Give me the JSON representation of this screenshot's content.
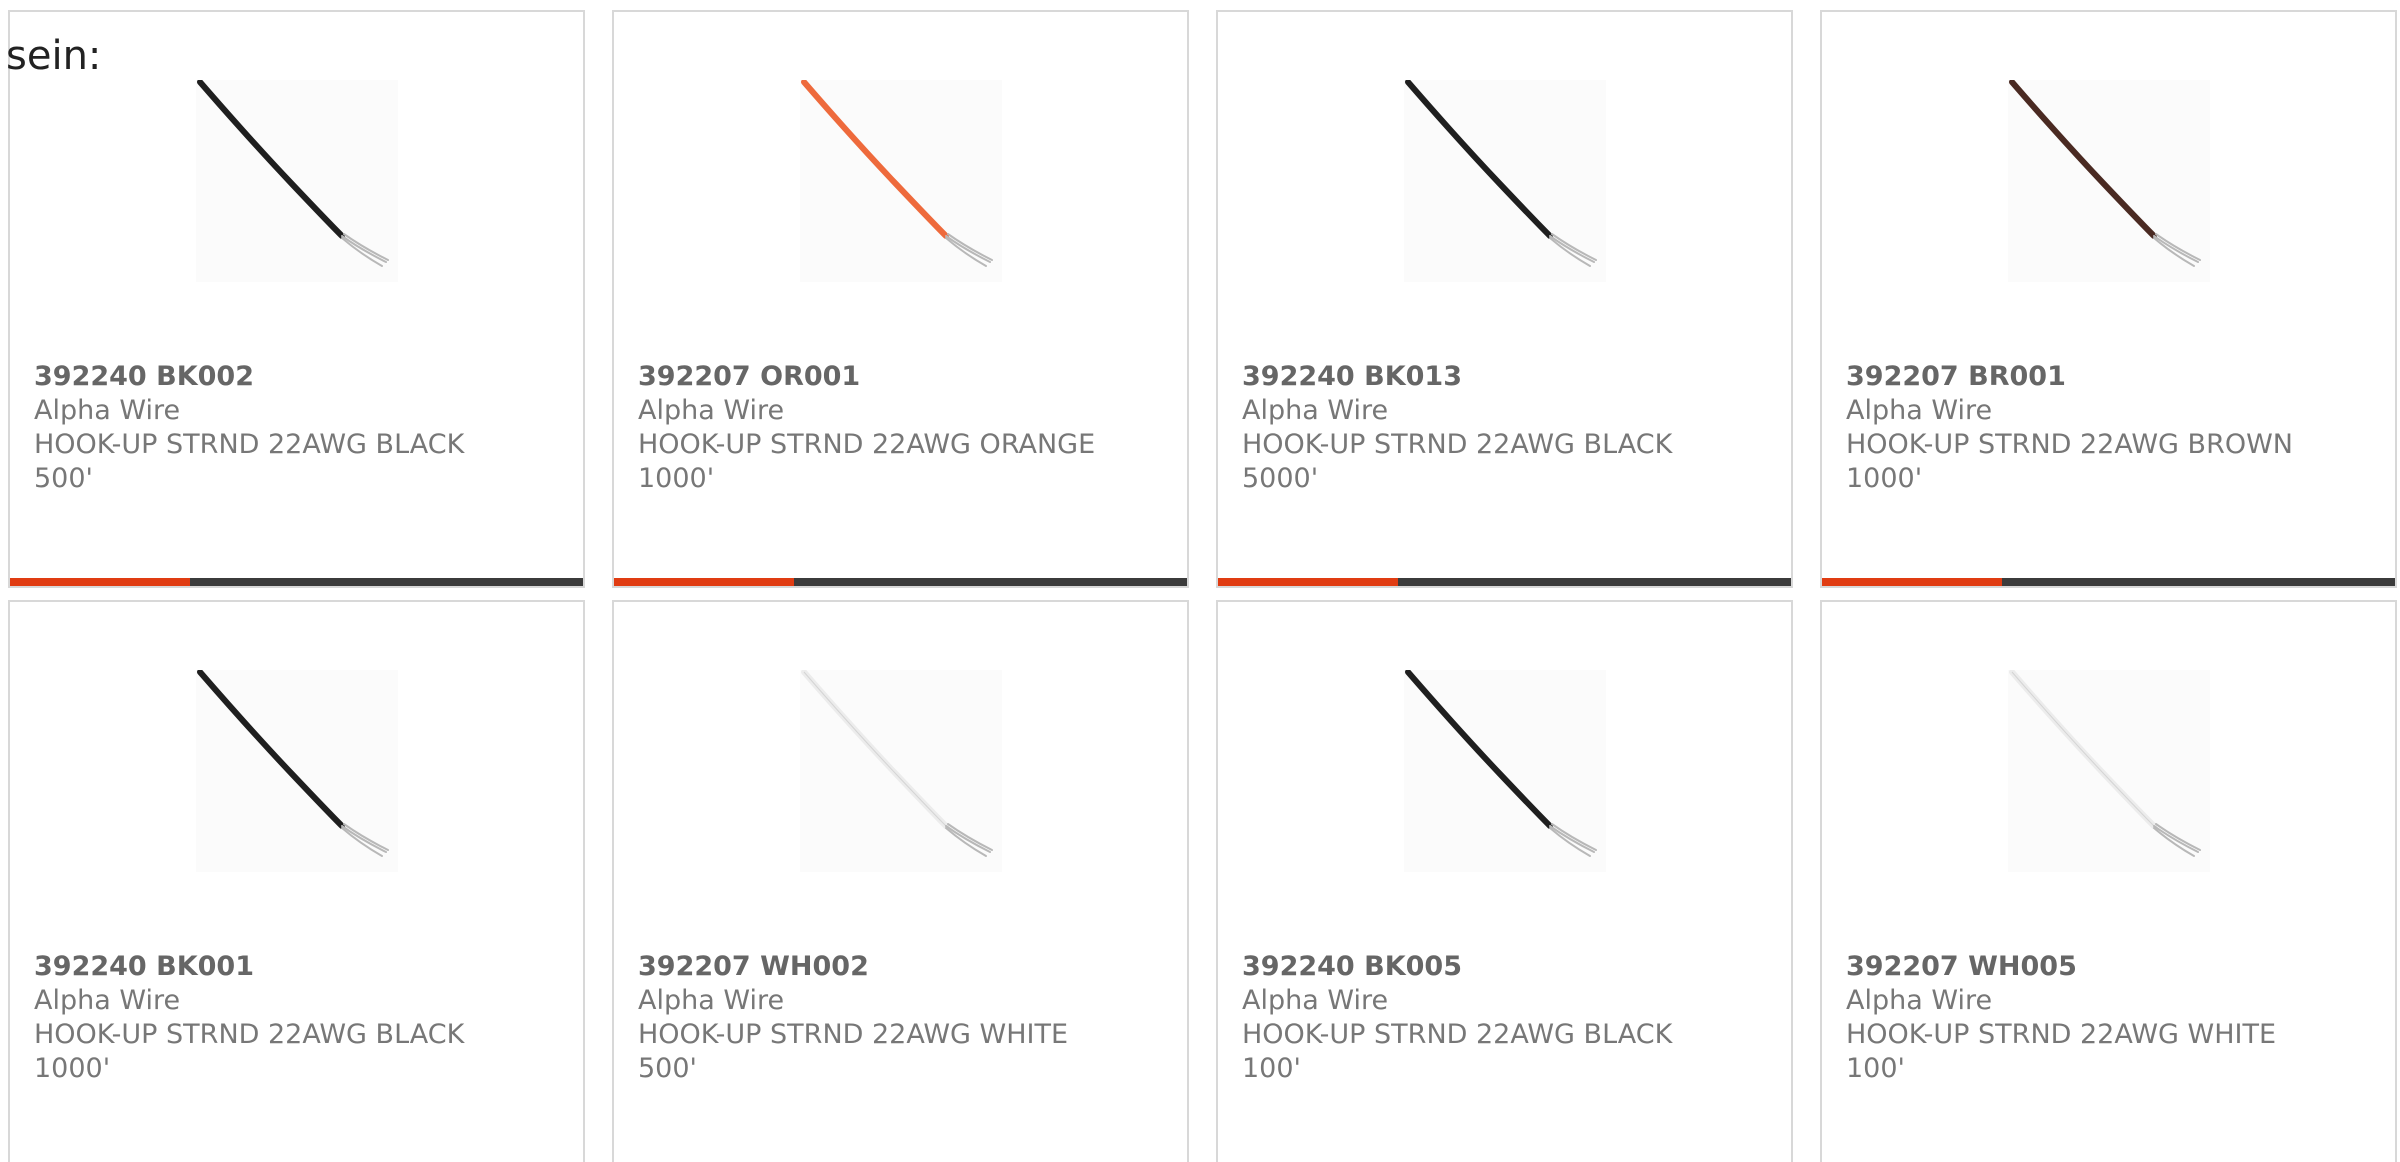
{
  "intro_text": "sein:",
  "accent_color": "#e03c12",
  "track_color": "#3b3b3b",
  "products": [
    {
      "part_number": "392240 BK002",
      "manufacturer": "Alpha Wire",
      "description": "HOOK-UP STRND 22AWG BLACK 500'",
      "image": "wire-black-icon",
      "wire_color": "#1f1f1f",
      "progress": 0.315
    },
    {
      "part_number": "392207 OR001",
      "manufacturer": "Alpha Wire",
      "description": "HOOK-UP STRND 22AWG ORANGE 1000'",
      "image": "wire-orange-icon",
      "wire_color": "#ee6a3c",
      "progress": 0.315
    },
    {
      "part_number": "392240 BK013",
      "manufacturer": "Alpha Wire",
      "description": "HOOK-UP STRND 22AWG BLACK 5000'",
      "image": "wire-black-icon",
      "wire_color": "#1f1f1f",
      "progress": 0.315
    },
    {
      "part_number": "392207 BR001",
      "manufacturer": "Alpha Wire",
      "description": "HOOK-UP STRND 22AWG BROWN 1000'",
      "image": "wire-brown-icon",
      "wire_color": "#4a2a22",
      "progress": 0.315
    },
    {
      "part_number": "392240 BK001",
      "manufacturer": "Alpha Wire",
      "description": "HOOK-UP STRND 22AWG BLACK 1000'",
      "image": "wire-black-icon",
      "wire_color": "#1f1f1f",
      "progress": null
    },
    {
      "part_number": "392207 WH002",
      "manufacturer": "Alpha Wire",
      "description": "HOOK-UP STRND 22AWG WHITE 500'",
      "image": "wire-white-icon",
      "wire_color": "#ececec",
      "progress": null
    },
    {
      "part_number": "392240 BK005",
      "manufacturer": "Alpha Wire",
      "description": "HOOK-UP STRND 22AWG BLACK 100'",
      "image": "wire-black-icon",
      "wire_color": "#1f1f1f",
      "progress": null
    },
    {
      "part_number": "392207 WH005",
      "manufacturer": "Alpha Wire",
      "description": "HOOK-UP STRND 22AWG WHITE 100'",
      "image": "wire-white-icon",
      "wire_color": "#ececec",
      "progress": null
    }
  ]
}
